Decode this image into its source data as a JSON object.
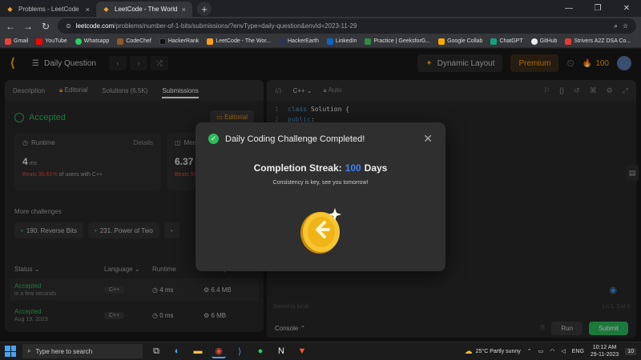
{
  "browser": {
    "tabs": [
      {
        "title": "Problems - LeetCode",
        "active": false
      },
      {
        "title": "LeetCode - The World's Leading",
        "active": true
      }
    ],
    "url_host": "leetcode.com",
    "url_path": "/problems/number-of-1-bits/submissions/?envType=daily-question&envId=2023-11-29",
    "bookmarks": [
      "Gmail",
      "YouTube",
      "Whatsapp",
      "CodeChef",
      "HackerRank",
      "LeetCode - The Wor...",
      "HackerEarth",
      "LinkedIn",
      "Practice | GeeksforG...",
      "Google Collab",
      "ChatGPT",
      "GitHub",
      "Strivers A2Z DSA Co..."
    ]
  },
  "header": {
    "title": "Daily Question",
    "dynamic_layout": "Dynamic Layout",
    "premium": "Premium",
    "coins": "100"
  },
  "left": {
    "tabs": [
      "Description",
      "Editorial",
      "Solutions (6.5K)",
      "Submissions"
    ],
    "status": "Accepted",
    "editorial_btn": "Editorial",
    "runtime": {
      "label": "Runtime",
      "details": "Details",
      "value": "4",
      "unit": "ms",
      "beats_pct": "Beats 30.61%",
      "beats_rest": "of users with C++"
    },
    "memory": {
      "label": "Mem",
      "value": "6.37",
      "unit": "M",
      "beats_pct": "Beats 57"
    },
    "more_challenges": "More challenges",
    "challenges": [
      "190. Reverse Bits",
      "231. Power of Two"
    ],
    "table_headers": [
      "Status",
      "Language",
      "Runtime",
      "Memory"
    ],
    "rows": [
      {
        "status": "Accepted",
        "when": "in a few seconds",
        "lang": "C++",
        "runtime": "4 ms",
        "memory": "6.4 MB"
      },
      {
        "status": "Accepted",
        "when": "Aug 19, 2023",
        "lang": "C++",
        "runtime": "0 ms",
        "memory": "6 MB"
      }
    ]
  },
  "right": {
    "language": "C++",
    "auto": "Auto",
    "code": [
      {
        "n": "1",
        "kw": "class",
        "rest": " Solution {"
      },
      {
        "n": "2",
        "kw": "public",
        "rest": ":"
      }
    ],
    "saved": "Saved to local",
    "position": "Ln 1, Col 1",
    "console": "Console",
    "run": "Run",
    "submit": "Submit"
  },
  "modal": {
    "title": "Daily Coding Challenge Completed!",
    "streak_label": "Completion Streak:",
    "streak_value": "100",
    "streak_unit": "Days",
    "message": "Consistency is key, see you tomorrow!"
  },
  "taskbar": {
    "search_placeholder": "Type here to search",
    "weather": "25°C  Partly sunny",
    "lang": "ENG",
    "time": "10:12 AM",
    "date": "29-11-2023",
    "notif": "10"
  }
}
